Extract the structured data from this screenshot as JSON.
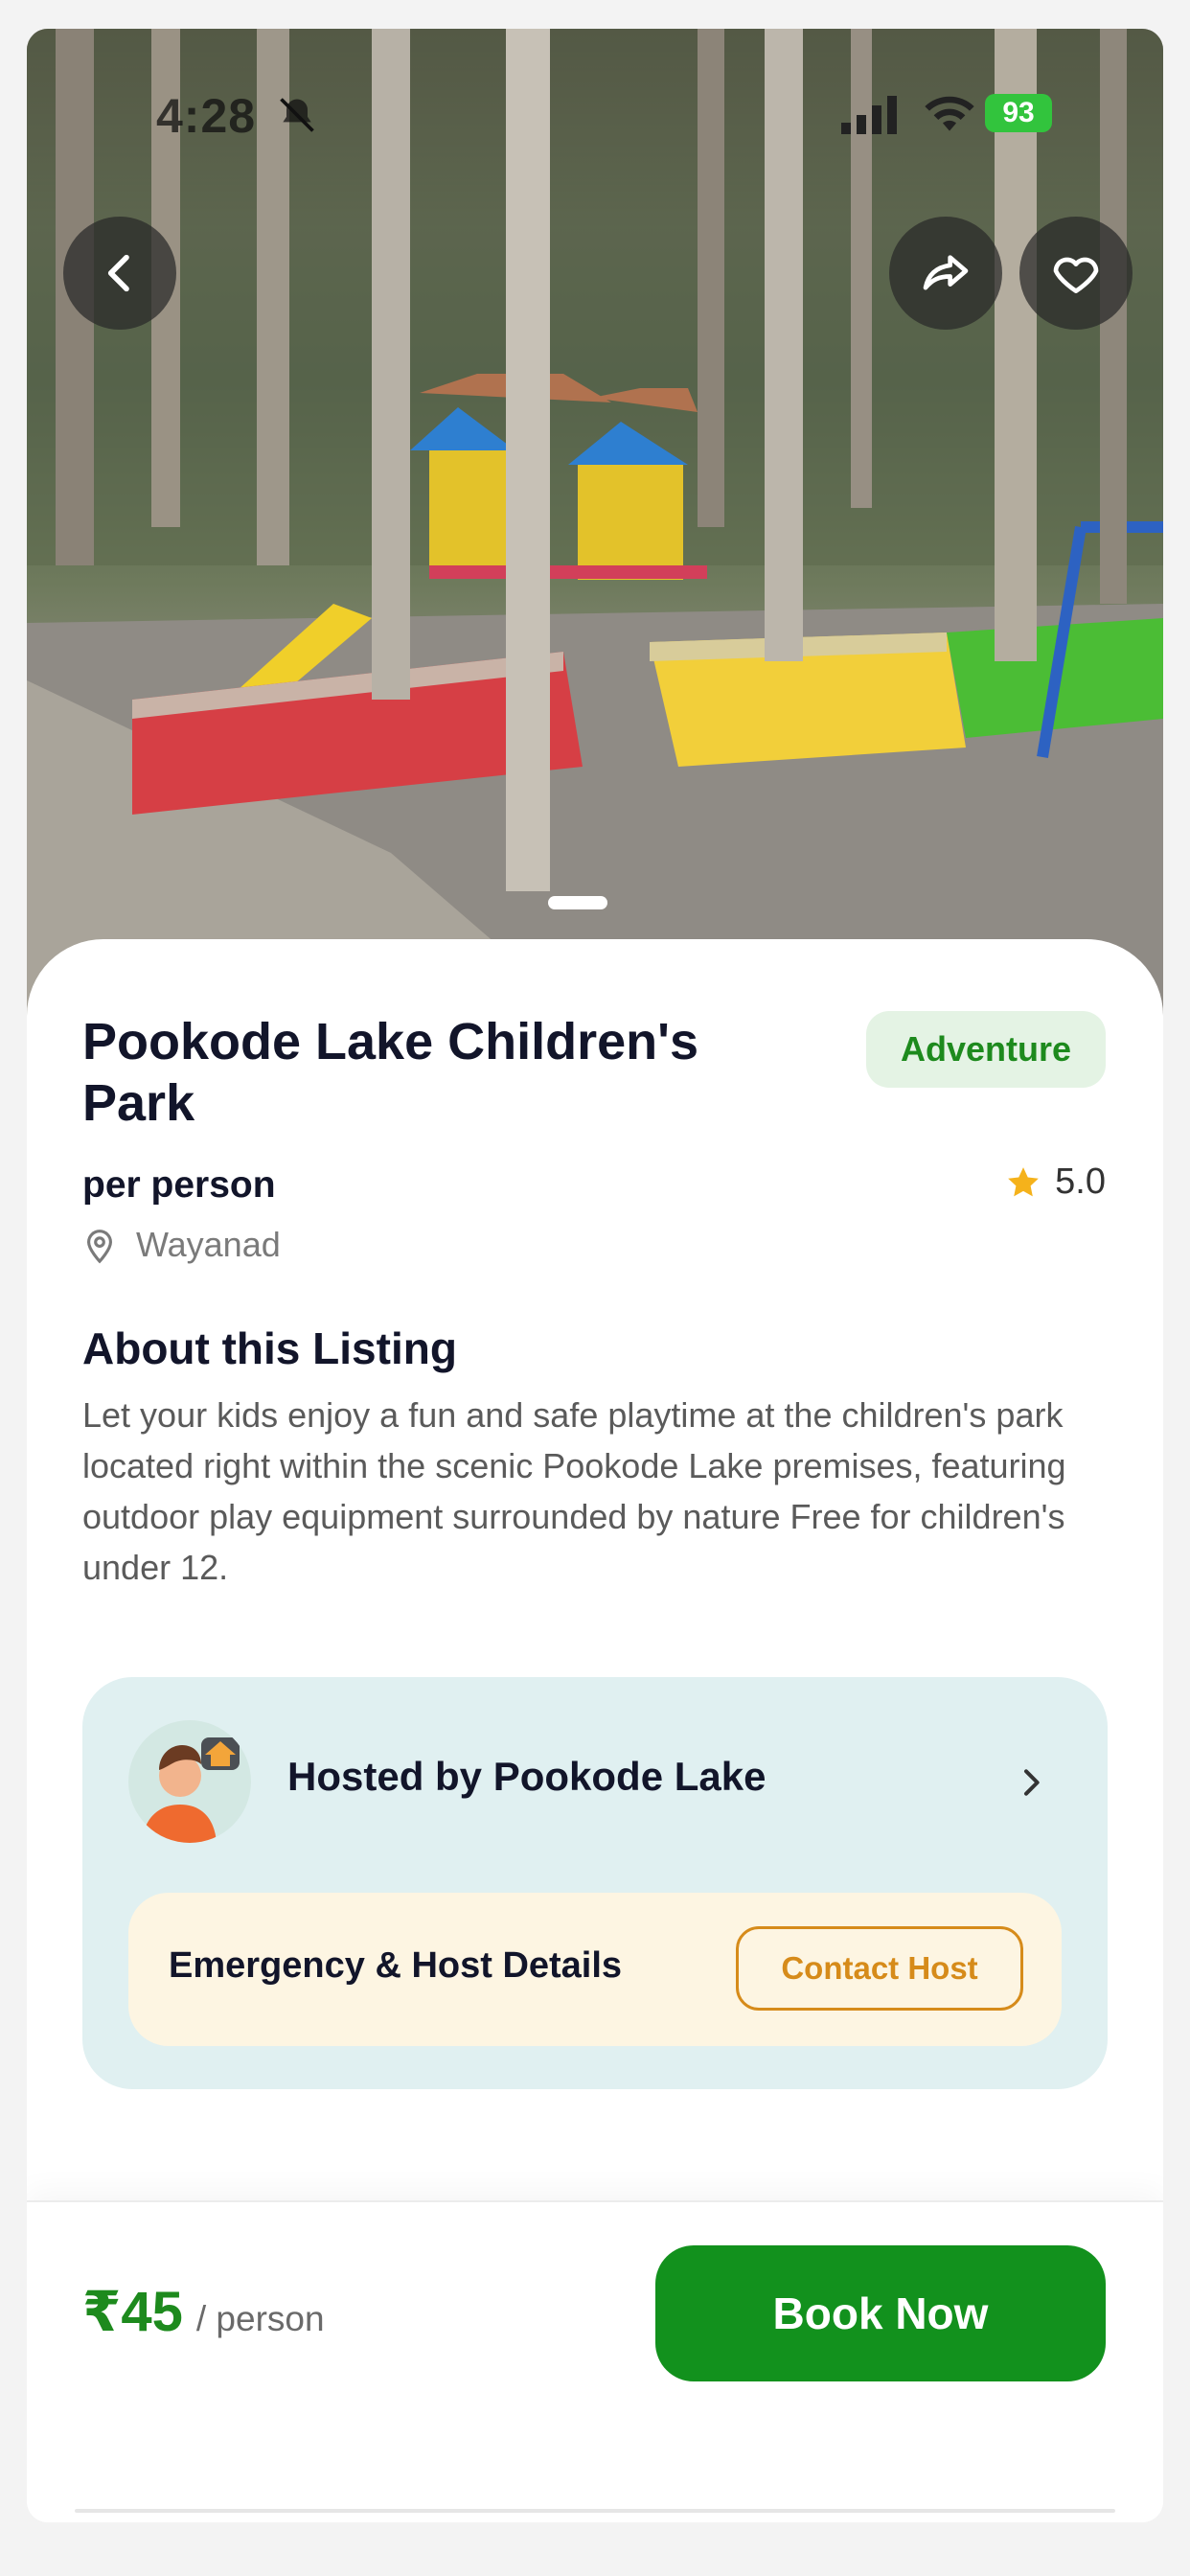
{
  "status_bar": {
    "time": "4:28",
    "battery": "93"
  },
  "hero": {
    "back_icon": "chevron-left-icon",
    "share_icon": "share-icon",
    "favorite_icon": "heart-icon"
  },
  "listing": {
    "title": "Pookode Lake Children's Park",
    "category": "Adventure",
    "price_label": "per person",
    "rating": "5.0",
    "location": "Wayanad"
  },
  "about": {
    "heading": "About this Listing",
    "text": "Let your kids enjoy a fun and safe playtime at the children's park located right within the scenic Pookode Lake premises, featuring outdoor play equipment surrounded by nature Free for children's under 12."
  },
  "host": {
    "label": "Hosted by Pookode Lake",
    "emergency_label": "Emergency & Host Details",
    "contact_button": "Contact Host"
  },
  "booking": {
    "price": "₹45",
    "unit": "/ person",
    "book_button": "Book Now"
  },
  "colors": {
    "primary_green": "#12911d",
    "badge_bg": "#e4f3e4",
    "host_card_bg": "#e0f0f1",
    "emergency_bg": "#fdf5e2",
    "contact_accent": "#d68b1a",
    "star": "#f5b21b"
  }
}
